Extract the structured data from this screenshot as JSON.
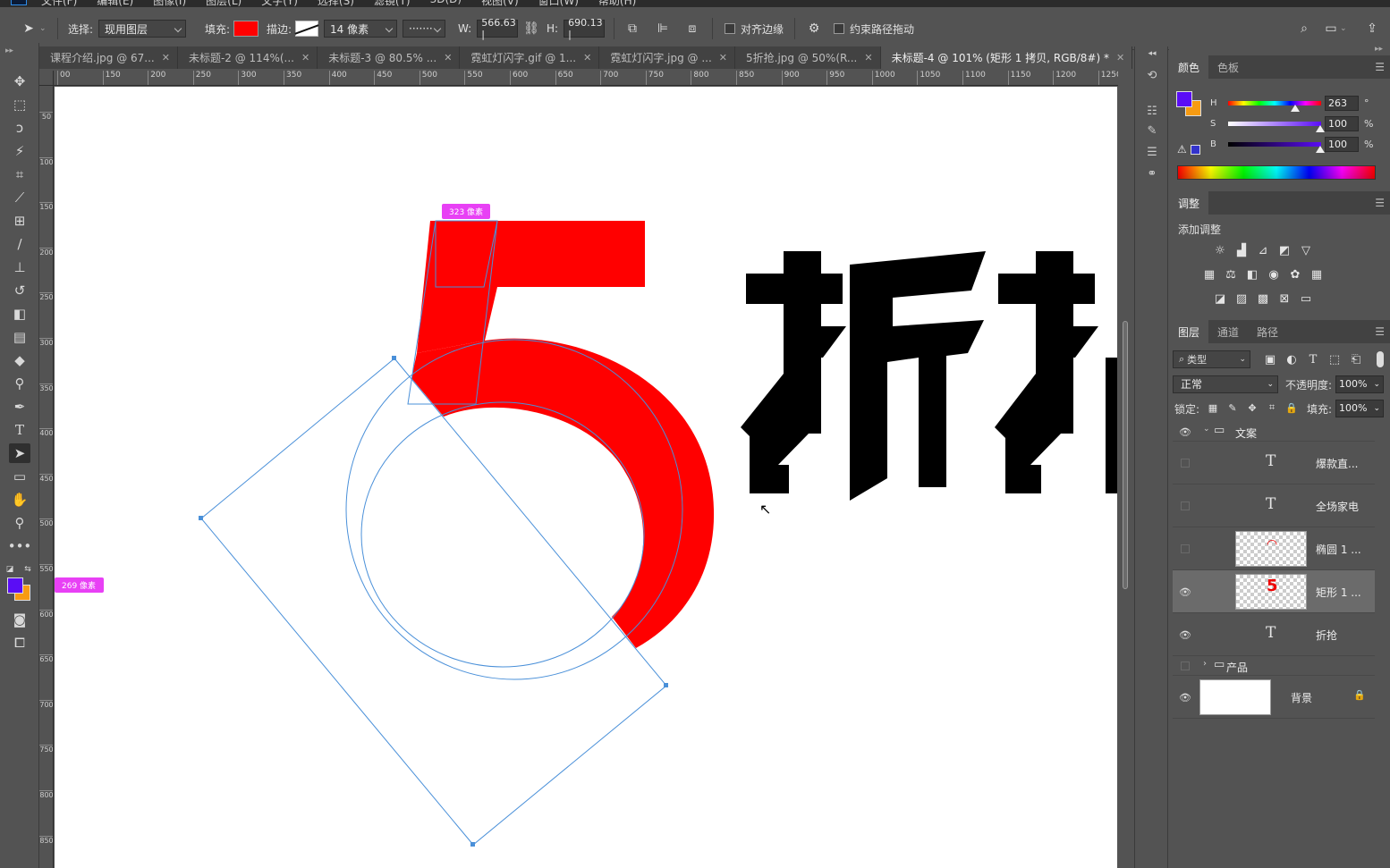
{
  "menubar": {
    "items": [
      "文件(F)",
      "编辑(E)",
      "图像(I)",
      "图层(L)",
      "文字(Y)",
      "选择(S)",
      "滤镜(T)",
      "3D(D)",
      "视图(V)",
      "窗口(W)",
      "帮助(H)"
    ]
  },
  "options": {
    "select_label": "选择:",
    "select_value": "现用图层",
    "fill_label": "填充:",
    "fill_color": "#ff0000",
    "stroke_label": "描边:",
    "stroke_width": "14 像素",
    "stroke_style": "·······",
    "w_label": "W:",
    "w_value": "566.63 |",
    "h_label": "H:",
    "h_value": "690.13 |",
    "align_edges": "对齐边缘",
    "constrain_path": "约束路径拖动"
  },
  "tabs": [
    {
      "label": "课程介绍.jpg @ 67..."
    },
    {
      "label": "未标题-2 @ 114%(..."
    },
    {
      "label": "未标题-3 @ 80.5% ..."
    },
    {
      "label": "霓虹灯闪字.gif @ 1..."
    },
    {
      "label": "霓虹灯闪字.jpg @ ..."
    },
    {
      "label": "5折抢.jpg @ 50%(R..."
    },
    {
      "label": "未标题-4 @ 101% (矩形 1 拷贝, RGB/8#) *"
    }
  ],
  "ruler_h": [
    "00",
    "150",
    "200",
    "250",
    "300",
    "350",
    "400",
    "450",
    "500",
    "550",
    "600",
    "650",
    "700",
    "750",
    "800",
    "850",
    "900",
    "950",
    "1000",
    "1050",
    "1100",
    "1150",
    "1200",
    "1250"
  ],
  "ruler_v": [
    "50",
    "100",
    "150",
    "200",
    "250",
    "300",
    "350",
    "400",
    "450",
    "500",
    "550",
    "600",
    "650",
    "700",
    "750",
    "800",
    "850"
  ],
  "canvas": {
    "tip_top": "323 像素",
    "tip_left": "269 像素",
    "big_text": "折抢",
    "digit_color": "#ff0000",
    "path_color": "#4a90d9"
  },
  "color_panel": {
    "tabs": [
      "颜色",
      "色板"
    ],
    "fg_color": "#5a0df5",
    "bg_color": "#f79b12",
    "h_label": "H",
    "s_label": "S",
    "b_label": "B",
    "h_value": "263",
    "s_value": "100",
    "b_value": "100",
    "h_unit": "°",
    "s_unit": "%",
    "b_unit": "%"
  },
  "adjust_panel": {
    "tab": "调整",
    "add_label": "添加调整"
  },
  "layers_panel": {
    "tabs": [
      "图层",
      "通道",
      "路径"
    ],
    "filter_label": "类型",
    "blend_mode": "正常",
    "opacity_label": "不透明度:",
    "opacity_value": "100%",
    "lock_label": "锁定:",
    "fill_label": "填充:",
    "fill_value": "100%",
    "layers": [
      {
        "name": "文案",
        "kind": "group",
        "visible": true,
        "expanded": true
      },
      {
        "name": "爆款直...",
        "kind": "text",
        "visible": false
      },
      {
        "name": "全场家电",
        "kind": "text",
        "visible": false
      },
      {
        "name": "椭圆 1 ...",
        "kind": "shape",
        "visible": false
      },
      {
        "name": "矩形 1 ...",
        "kind": "shape",
        "visible": true,
        "selected": true
      },
      {
        "name": "折抢",
        "kind": "text",
        "visible": true
      },
      {
        "name": "产品",
        "kind": "group",
        "visible": false,
        "expanded": false
      },
      {
        "name": "背景",
        "kind": "background",
        "visible": true,
        "locked": true
      }
    ]
  }
}
